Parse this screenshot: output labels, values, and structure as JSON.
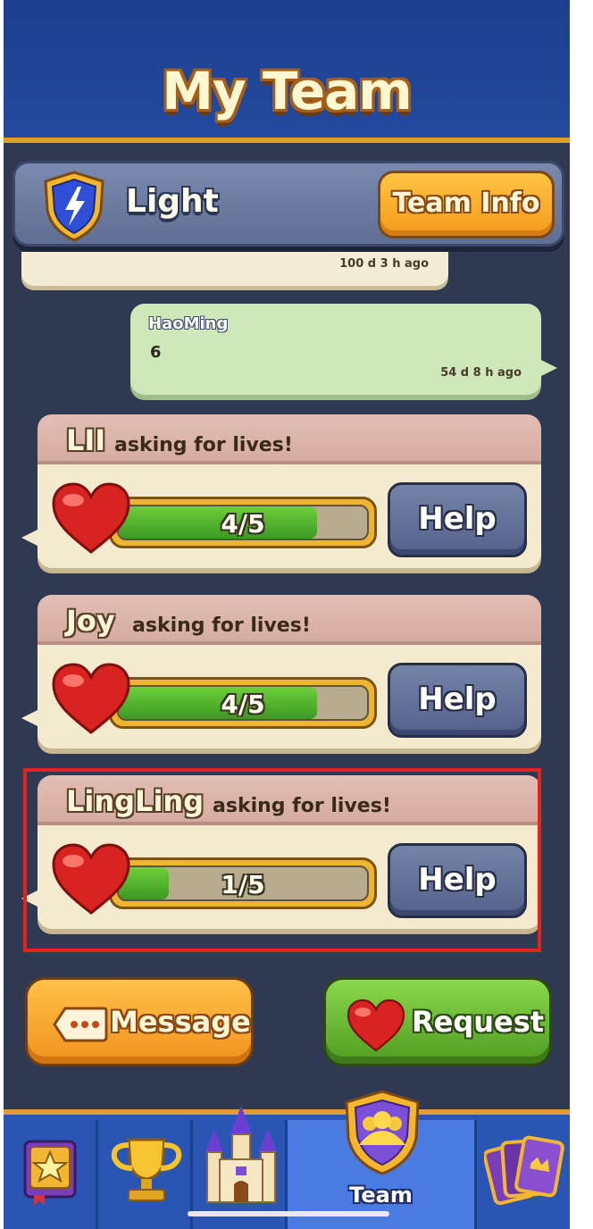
{
  "header": {
    "title": "My Team"
  },
  "team": {
    "name": "Light",
    "info_button": "Team Info",
    "badge_icon": "lightning-shield-icon"
  },
  "chat": {
    "previous_message_time": "100 d 3 h ago",
    "message": {
      "author": "HaoMing",
      "text": "6",
      "time": "54 d 8 h ago"
    }
  },
  "requests": [
    {
      "name": "LII",
      "asking_text": "asking for lives!",
      "lives": "4/5",
      "fill": 0.8,
      "help_label": "Help"
    },
    {
      "name": "Joy",
      "asking_text": "asking for lives!",
      "lives": "4/5",
      "fill": 0.8,
      "help_label": "Help"
    },
    {
      "name": "LingLing",
      "asking_text": "asking for lives!",
      "lives": "1/5",
      "fill": 0.2,
      "help_label": "Help"
    }
  ],
  "actions": {
    "message_label": "Message",
    "request_label": "Request"
  },
  "nav": {
    "items": [
      {
        "icon": "star-book-icon"
      },
      {
        "icon": "trophy-icon"
      },
      {
        "icon": "castle-icon"
      },
      {
        "icon": "team-icon",
        "label": "Team"
      },
      {
        "icon": "cards-icon"
      }
    ]
  },
  "colors": {
    "accent": "#e89a2c",
    "highlight": "#e4231b",
    "header_bg": "#1d3f8f"
  }
}
